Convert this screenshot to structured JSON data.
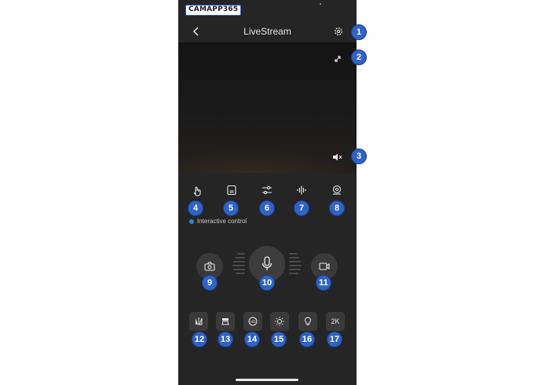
{
  "app": {
    "logo_text": "CAMAPP365",
    "title": "LiveStream"
  },
  "colors": {
    "accent": "#2f63c8",
    "background": "#252525",
    "indicator": "#2f86d6"
  },
  "toolbar": {
    "items": [
      {
        "icon": "hand-icon",
        "badge": "4"
      },
      {
        "icon": "sd-card-icon",
        "badge": "5"
      },
      {
        "icon": "sliders-icon",
        "badge": "6"
      },
      {
        "icon": "sound-wave-icon",
        "badge": "7"
      },
      {
        "icon": "ptz-camera-icon",
        "badge": "8"
      }
    ],
    "interactive_label": "Interactive control"
  },
  "controls": {
    "snapshot_badge": "9",
    "mic_badge": "10",
    "record_badge": "11"
  },
  "bottom_bar": {
    "items": [
      {
        "icon": "flip-icon",
        "badge": "12"
      },
      {
        "icon": "night-mode-icon",
        "badge": "13"
      },
      {
        "icon": "wdr-icon",
        "badge": "14"
      },
      {
        "icon": "brightness-icon",
        "badge": "15"
      },
      {
        "icon": "light-bulb-icon",
        "badge": "16"
      },
      {
        "icon": "resolution-icon",
        "label": "2K",
        "badge": "17"
      }
    ]
  },
  "badges": {
    "settings": "1",
    "fullscreen": "2",
    "mute": "3"
  }
}
